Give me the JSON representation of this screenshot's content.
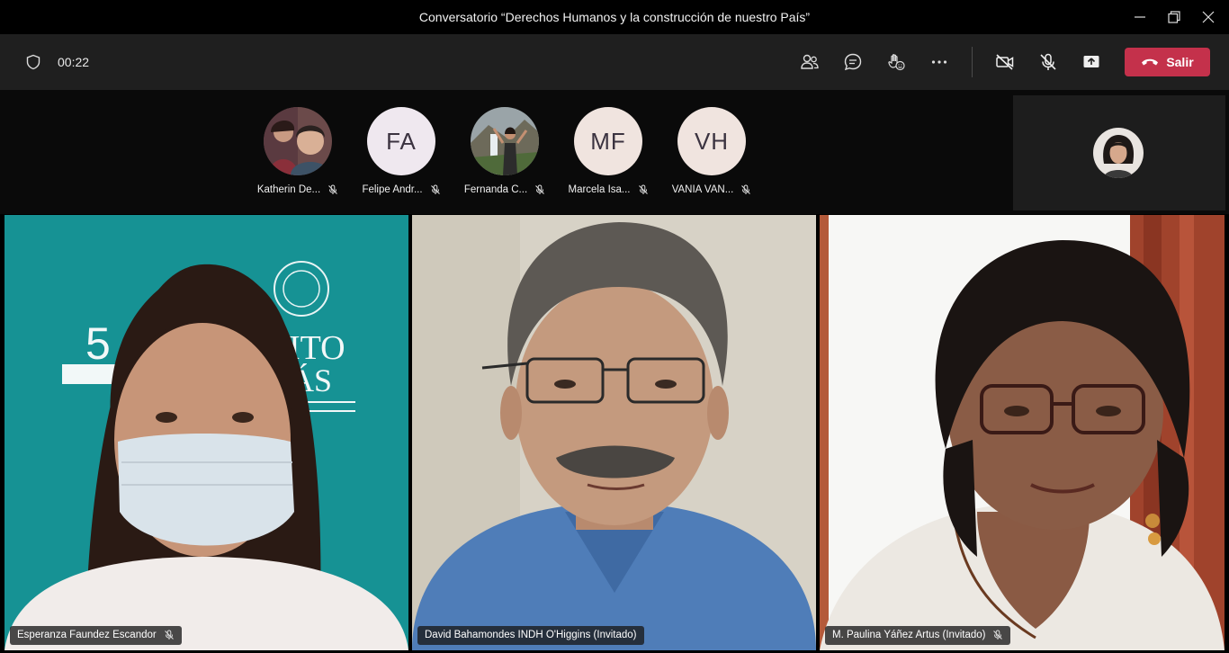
{
  "window": {
    "title": "Conversatorio “Derechos Humanos y la construcción de nuestro País”"
  },
  "toolbar": {
    "timer": "00:22",
    "leave_label": "Salir",
    "icons": [
      "shield-icon",
      "participants-icon",
      "chat-icon",
      "reactions-icon",
      "more-icon",
      "camera-off-icon",
      "mic-off-icon",
      "share-icon",
      "phone-icon"
    ],
    "leave_color": "#c4314b"
  },
  "participants": [
    {
      "name": "Katherin De...",
      "type": "photo"
    },
    {
      "name": "Felipe Andr...",
      "initials": "FA"
    },
    {
      "name": "Fernanda C...",
      "type": "photo"
    },
    {
      "name": "Marcela Isa...",
      "initials": "MF"
    },
    {
      "name": "VANIA VAN...",
      "initials": "VH"
    }
  ],
  "videos": [
    {
      "name": "Esperanza Faundez Escandor"
    },
    {
      "name": "David Bahamondes INDH O'Higgins (Invitado)"
    },
    {
      "name": "M. Paulina Yáñez Artus (Invitado)"
    }
  ]
}
